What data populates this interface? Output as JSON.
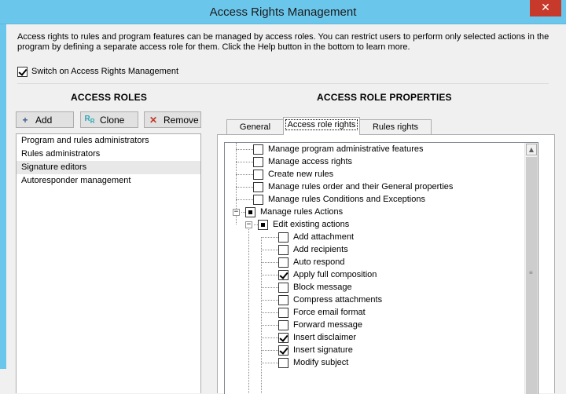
{
  "window": {
    "title": "Access Rights Management",
    "close_label": "✕"
  },
  "intro_text": "Access rights to rules and program features can be managed by access roles. You can restrict users to perform only selected actions in the program by defining a separate access role for them. Click the Help button in the bottom to learn more.",
  "switch": {
    "label": "Switch on Access Rights Management",
    "checked": true
  },
  "roles": {
    "title": "ACCESS ROLES",
    "buttons": [
      {
        "label": "Add",
        "icon": "plus-icon"
      },
      {
        "label": "Clone",
        "icon": "clone-icon"
      },
      {
        "label": "Remove",
        "icon": "remove-icon"
      }
    ],
    "items": [
      {
        "label": "Program and rules administrators"
      },
      {
        "label": "Rules administrators"
      },
      {
        "label": "Signature editors",
        "selected": true
      },
      {
        "label": "Autoresponder management"
      }
    ]
  },
  "properties": {
    "title": "ACCESS ROLE PROPERTIES",
    "tabs": [
      {
        "label": "General"
      },
      {
        "label": "Access role rights",
        "active": true
      },
      {
        "label": "Rules rights"
      }
    ],
    "tree": [
      {
        "label": "Manage program administrative features",
        "state": "unchecked",
        "level": 0
      },
      {
        "label": "Manage access rights",
        "state": "unchecked",
        "level": 0
      },
      {
        "label": "Create new rules",
        "state": "unchecked",
        "level": 0
      },
      {
        "label": "Manage rules order and their General properties",
        "state": "unchecked",
        "level": 0
      },
      {
        "label": "Manage rules Conditions and Exceptions",
        "state": "unchecked",
        "level": 0
      },
      {
        "label": "Manage rules Actions",
        "state": "partial",
        "level": 0,
        "expanded": true
      },
      {
        "label": "Edit existing actions",
        "state": "partial",
        "level": 1,
        "expanded": true
      },
      {
        "label": "Add attachment",
        "state": "unchecked",
        "level": 2
      },
      {
        "label": "Add recipients",
        "state": "unchecked",
        "level": 2
      },
      {
        "label": "Auto respond",
        "state": "unchecked",
        "level": 2
      },
      {
        "label": "Apply full composition",
        "state": "checked",
        "level": 2
      },
      {
        "label": "Block message",
        "state": "unchecked",
        "level": 2
      },
      {
        "label": "Compress attachments",
        "state": "unchecked",
        "level": 2
      },
      {
        "label": "Force email format",
        "state": "unchecked",
        "level": 2
      },
      {
        "label": "Forward message",
        "state": "unchecked",
        "level": 2
      },
      {
        "label": "Insert disclaimer",
        "state": "checked",
        "level": 2
      },
      {
        "label": "Insert signature",
        "state": "checked",
        "level": 2
      },
      {
        "label": "Modify subject",
        "state": "unchecked",
        "level": 2
      }
    ]
  },
  "colors": {
    "titlebar": "#6bc6ec",
    "close": "#c7392b"
  }
}
